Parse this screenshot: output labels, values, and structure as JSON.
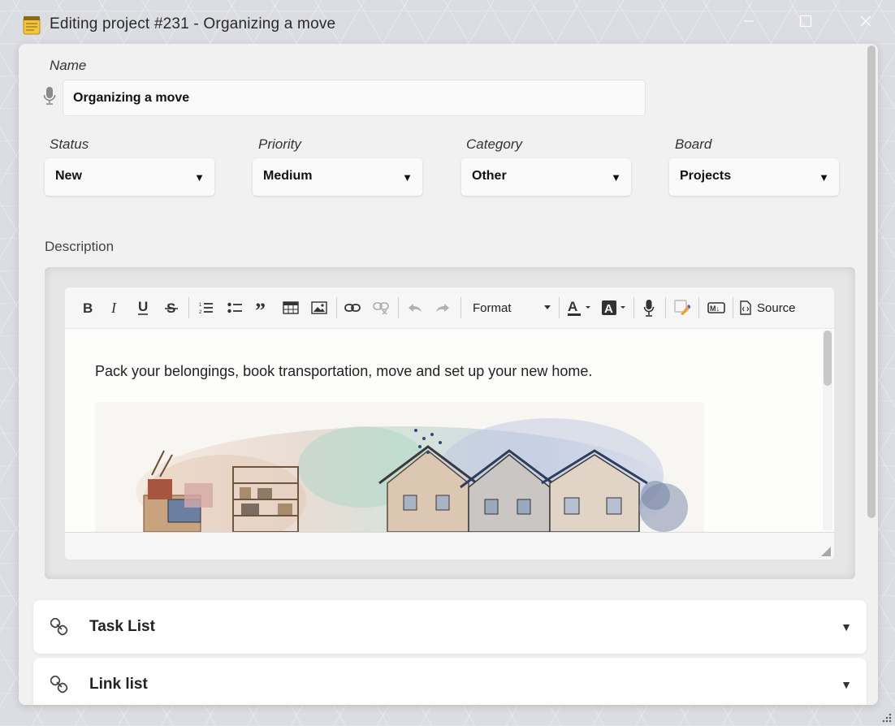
{
  "window": {
    "title": "Editing project #231 - Organizing a move",
    "icons": {
      "app": "notepad-icon",
      "minimize": "minimize-icon",
      "maximize": "maximize-icon",
      "close": "close-icon"
    }
  },
  "form": {
    "name": {
      "label": "Name",
      "value": "Organizing a move",
      "mic_icon": "microphone-icon"
    },
    "status": {
      "label": "Status",
      "value": "New"
    },
    "priority": {
      "label": "Priority",
      "value": "Medium"
    },
    "category": {
      "label": "Category",
      "value": "Other"
    },
    "board": {
      "label": "Board",
      "value": "Projects"
    },
    "dropdown_arrow": "▼"
  },
  "description": {
    "label": "Description",
    "toolbar": {
      "buttons": [
        "bold-icon",
        "italic-icon",
        "underline-icon",
        "strikethrough-icon",
        "numbered-list-icon",
        "bulleted-list-icon",
        "blockquote-icon",
        "table-icon",
        "image-icon",
        "link-icon",
        "unlink-icon",
        "undo-icon",
        "redo-icon",
        "text-color-icon",
        "background-color-icon",
        "microphone-icon",
        "copy-formatting-icon",
        "markdown-icon",
        "source-icon"
      ],
      "format_label": "Format",
      "source_label": "Source",
      "markdown_label": "M↓"
    },
    "text": "Pack your belongings, book transportation, move and set up your new home.",
    "image": "watercolor-houses-moving-boxes-illustration"
  },
  "sections": [
    {
      "title": "Task List",
      "icon": "link-icon",
      "arrow": "▼"
    },
    {
      "title": "Link list",
      "icon": "link-icon",
      "arrow": "▼"
    }
  ],
  "colors": {
    "dialog_bg": "#f1f1f1",
    "field_bg": "#fafafa",
    "text": "#222222"
  }
}
